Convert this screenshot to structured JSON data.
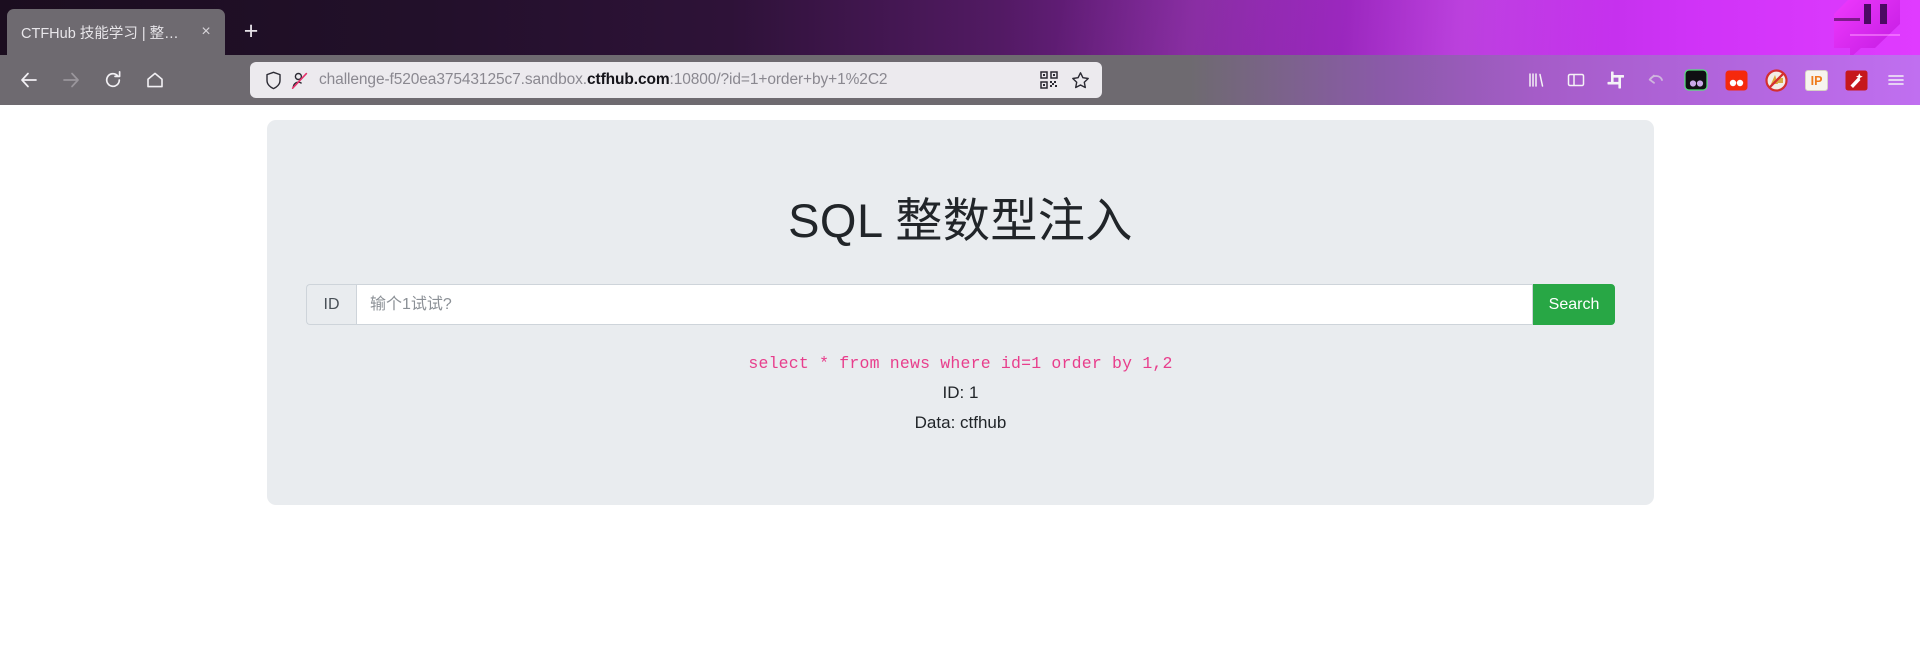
{
  "browser": {
    "tab": {
      "title": "CTFHub 技能学习 | 整数型注入",
      "close_label": "×"
    },
    "new_tab_label": "+",
    "nav": {
      "back": "back-arrow",
      "forward": "forward-arrow",
      "reload": "reload",
      "home": "home"
    },
    "url": {
      "prefix": "challenge-f520ea37543125c7.sandbox.",
      "host": "ctfhub.com",
      "suffix": ":10800/?id=1+order+by+1%2C2",
      "full": "challenge-f520ea37543125c7.sandbox.ctfhub.com:10800/?id=1+order+by+1%2C2",
      "shield_icon": "shield-icon",
      "tracker_icon": "tracking-protection-off-icon",
      "qr_icon": "qr-code-icon",
      "bookmark_icon": "bookmark-star-icon"
    },
    "toolbar_icons": [
      "library-icon",
      "sidebar-icon",
      "screenshot-crop-icon",
      "undo-close-tab-icon",
      "dark-reader-extension-icon",
      "red-extension-icon",
      "noscript-extension-icon",
      "ip-extension-icon",
      "wappalyzer-extension-icon",
      "app-menu-icon"
    ]
  },
  "page": {
    "title": "SQL 整数型注入",
    "form": {
      "prefix_label": "ID",
      "input_value": "",
      "input_placeholder": "输个1试试?",
      "submit_label": "Search"
    },
    "output": {
      "sql_query": "select * from news where id=1 order by 1,2",
      "id_line": "ID: 1",
      "data_line": "Data: ctfhub"
    }
  },
  "colors": {
    "accent_green": "#28a745",
    "sql_pink": "#e83e8c",
    "panel_bg": "#e9ecef",
    "chrome_purple": "#b265dd"
  }
}
